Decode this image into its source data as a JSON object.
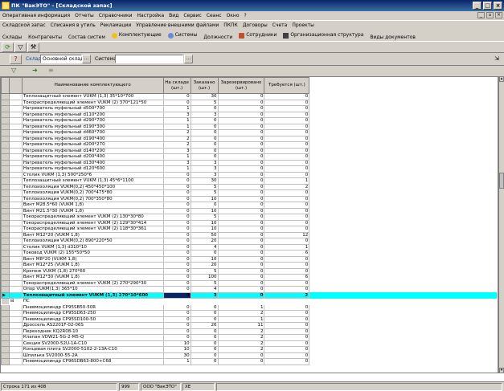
{
  "window": {
    "title": "ПК \"ВакЭТО\" - [Складской запас]"
  },
  "menu": [
    "Оперативная информация",
    "Отчеты",
    "Справочники",
    "Настройка",
    "Вид",
    "Сервис",
    "Сеанс",
    "Окно",
    "?"
  ],
  "toolbar1": [
    "Складской запас",
    "Списания в утиль",
    "Рекламации",
    "Управление внешними файлами",
    "ПКПК",
    "Договоры",
    "Счета",
    "Проекты"
  ],
  "toolbar2": [
    {
      "label": "Склады",
      "icon": "none"
    },
    {
      "label": "Контрагенты",
      "icon": "none"
    },
    {
      "label": "Состав систем",
      "icon": "none"
    },
    {
      "label": "Комплектующие",
      "icon": "yellow-circle-icon"
    },
    {
      "label": "Системы",
      "icon": "blue-circle-icon"
    },
    {
      "label": "Должности",
      "icon": "none"
    },
    {
      "label": "Сотрудники",
      "icon": "people-icon"
    },
    {
      "label": "Организационная структура",
      "icon": "org-icon"
    },
    {
      "label": "Виды документов",
      "icon": "none"
    }
  ],
  "filter": {
    "warehouse_label": "Склад",
    "warehouse_value": "Основной склад",
    "system_label": "Система",
    "system_value": "",
    "ellipsis": "..."
  },
  "grid": {
    "columns": [
      "Наименование комплектующего",
      "На складе (шт.)",
      "Заказано (шт.)",
      "Зарезервировано (шт.)",
      "Требуется (шт.)"
    ],
    "rows": [
      {
        "name": "Теплозащитный элемент VUKM (1,3) 35*10*700",
        "stock": "0",
        "ordered": "30",
        "reserved": "0",
        "required": "0"
      },
      {
        "name": "Токораспределяющий элемент VUKM (2) 370*121*50",
        "stock": "0",
        "ordered": "5",
        "reserved": "0",
        "required": "0"
      },
      {
        "name": "Нагреватель муфельный d500*700",
        "stock": "1",
        "ordered": "0",
        "reserved": "0",
        "required": "0"
      },
      {
        "name": "Нагреватель муфельный d110*200",
        "stock": "3",
        "ordered": "3",
        "reserved": "0",
        "required": "0"
      },
      {
        "name": "Нагреватель муфельный d290*700",
        "stock": "1",
        "ordered": "0",
        "reserved": "0",
        "required": "0"
      },
      {
        "name": "Нагреватель муфельный d190*300",
        "stock": "1",
        "ordered": "0",
        "reserved": "0",
        "required": "0"
      },
      {
        "name": "Нагреватель муфельный d460*700",
        "stock": "2",
        "ordered": "0",
        "reserved": "0",
        "required": "0"
      },
      {
        "name": "Нагреватель муфельный d190*400",
        "stock": "2",
        "ordered": "0",
        "reserved": "0",
        "required": "0"
      },
      {
        "name": "Нагреватель муфельный d200*270",
        "stock": "2",
        "ordered": "0",
        "reserved": "0",
        "required": "0"
      },
      {
        "name": "Нагреватель муфельный d140*200",
        "stock": "3",
        "ordered": "0",
        "reserved": "0",
        "required": "0"
      },
      {
        "name": "Нагреватель муфельный d200*400",
        "stock": "1",
        "ordered": "0",
        "reserved": "0",
        "required": "0"
      },
      {
        "name": "Нагреватель муфельный d130*400",
        "stock": "3",
        "ordered": "3",
        "reserved": "0",
        "required": "0"
      },
      {
        "name": "Нагреватель муфельный d120*600",
        "stock": "1",
        "ordered": "3",
        "reserved": "0",
        "required": "0"
      },
      {
        "name": "Столик VUKM (1,3) 500*250*6",
        "stock": "0",
        "ordered": "3",
        "reserved": "0",
        "required": "0"
      },
      {
        "name": "Теплозащитный элемент VUKM (1,3) 45*6*1100",
        "stock": "0",
        "ordered": "30",
        "reserved": "0",
        "required": "1"
      },
      {
        "name": "Теплоизоляция VUKM(0,2) 450*450*100",
        "stock": "0",
        "ordered": "5",
        "reserved": "0",
        "required": "2"
      },
      {
        "name": "Теплоизоляция VUKM(0,2) 700*475*80",
        "stock": "0",
        "ordered": "5",
        "reserved": "0",
        "required": "0"
      },
      {
        "name": "Теплоизоляция VUKM(0,2) 700*350*80",
        "stock": "0",
        "ordered": "10",
        "reserved": "0",
        "required": "0"
      },
      {
        "name": "Винт M28.5*60 (VUKM 1,8)",
        "stock": "0",
        "ordered": "0",
        "reserved": "0",
        "required": "0"
      },
      {
        "name": "Винт M21.5*30 (VUKM 1,8)",
        "stock": "0",
        "ordered": "10",
        "reserved": "0",
        "required": "0"
      },
      {
        "name": "Токораспределяющий элемент VUKM (2) 130*30*80",
        "stock": "0",
        "ordered": "5",
        "reserved": "0",
        "required": "0"
      },
      {
        "name": "Токораспределяющий элемент VUKM (2) 129*30*414",
        "stock": "0",
        "ordered": "10",
        "reserved": "0",
        "required": "0"
      },
      {
        "name": "Токораспределяющий элемент VUKM (2) 118*30*361",
        "stock": "0",
        "ordered": "10",
        "reserved": "0",
        "required": "0"
      },
      {
        "name": "Винт M12*20 (VUKM 1,8)",
        "stock": "0",
        "ordered": "50",
        "reserved": "0",
        "required": "12"
      },
      {
        "name": "Теплоизоляция VUKM(0,2) 890*220*50",
        "stock": "0",
        "ordered": "20",
        "reserved": "0",
        "required": "0"
      },
      {
        "name": "Столик VUKM (1,3) d310*10",
        "stock": "0",
        "ordered": "4",
        "reserved": "0",
        "required": "1"
      },
      {
        "name": "Токовод VUKM (2) 155*50*50",
        "stock": "0",
        "ordered": "0",
        "reserved": "0",
        "required": "6"
      },
      {
        "name": "Винт M8*20 (VUKM 1,8)",
        "stock": "0",
        "ordered": "10",
        "reserved": "0",
        "required": "0"
      },
      {
        "name": "Винт M12*25 (VUKM 1,8)",
        "stock": "0",
        "ordered": "20",
        "reserved": "0",
        "required": "0"
      },
      {
        "name": "Крепеж VUKM (1,8) 270*60",
        "stock": "0",
        "ordered": "5",
        "reserved": "0",
        "required": "0"
      },
      {
        "name": "Винт M12*30 (VUKM 1,8)",
        "stock": "0",
        "ordered": "100",
        "reserved": "0",
        "required": "6"
      },
      {
        "name": "Токораспределяющий элемент VUKM (2) 270*290*30",
        "stock": "0",
        "ordered": "5",
        "reserved": "0",
        "required": "0"
      },
      {
        "name": "Опор VUKM(1,3) 365*10",
        "stock": "0",
        "ordered": "4",
        "reserved": "0",
        "required": "0"
      },
      {
        "name": "Теплозащитный элемент VUKM (1,3) 270*10*600",
        "stock": "0",
        "ordered": "3",
        "reserved": "0",
        "required": "2",
        "selected": true
      },
      {
        "name": "ПС",
        "stock": "",
        "ordered": "",
        "reserved": "",
        "required": "",
        "group": true
      },
      {
        "name": "Пневмоцилиндр CP95SB50-50R",
        "stock": "0",
        "ordered": "0",
        "reserved": "1",
        "required": "0"
      },
      {
        "name": "Пневмоцилиндр CP95SD63-250",
        "stock": "0",
        "ordered": "0",
        "reserved": "2",
        "required": "0"
      },
      {
        "name": "Пневмоцилиндр CP95SD100-50",
        "stock": "0",
        "ordered": "0",
        "reserved": "1",
        "required": "0"
      },
      {
        "name": "Дроссель AS2201F-02-06S",
        "stock": "0",
        "ordered": "26",
        "reserved": "11",
        "required": "0"
      },
      {
        "name": "Переходник KQ2R08-10",
        "stock": "0",
        "ordered": "0",
        "reserved": "2",
        "required": "0"
      },
      {
        "name": "Клапан VDW21-5G-2-M5-Q",
        "stock": "0",
        "ordered": "0",
        "reserved": "2",
        "required": "0"
      },
      {
        "name": "Секция SV2000-52U-1A-C10",
        "stock": "10",
        "ordered": "0",
        "reserved": "2",
        "required": "0"
      },
      {
        "name": "Концевая плита SV2000-5102-2-13A-C10",
        "stock": "10",
        "ordered": "0",
        "reserved": "2",
        "required": "0"
      },
      {
        "name": "Шпилька SV2000-55-2A",
        "stock": "30",
        "ordered": "0",
        "reserved": "0",
        "required": "0"
      },
      {
        "name": "Пневмоцилиндр CP96SDB63-800+C68",
        "stock": "1",
        "ordered": "0",
        "reserved": "0",
        "required": "0"
      }
    ]
  },
  "status": {
    "row_info": "Строка 171 из 408",
    "user_id": "999",
    "company": "ООО \"ВакЭТО\"",
    "flag": "ХЕ"
  }
}
